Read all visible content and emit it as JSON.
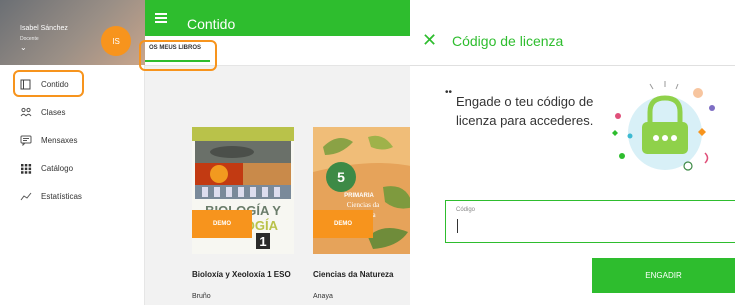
{
  "profile": {
    "name": "Isabel Sánchez",
    "role": "Docente",
    "initials": "IS"
  },
  "sidebar": {
    "items": [
      {
        "label": "Contido",
        "icon": "book-icon"
      },
      {
        "label": "Clases",
        "icon": "people-icon"
      },
      {
        "label": "Mensaxes",
        "icon": "message-icon"
      },
      {
        "label": "Catálogo",
        "icon": "grid-icon"
      },
      {
        "label": "Estatísticas",
        "icon": "chart-icon"
      }
    ]
  },
  "header": {
    "title": "Contido"
  },
  "tabs": [
    {
      "label": "OS MEUS LIBROS"
    }
  ],
  "books": [
    {
      "title": "Bioloxía y Xeoloxía 1 ESO",
      "publisher": "Bruño",
      "badge": "DEMO",
      "cover_text": "BIOLOGÍA Y GEOLOGÍA",
      "cover_number": "1"
    },
    {
      "title": "Ciencias da Natureza",
      "publisher": "Anaya",
      "badge": "DEMO",
      "cover_number": "5",
      "cover_grade": "PRIMARIA",
      "cover_subject": "Ciencias da Natureza"
    }
  ],
  "dialog": {
    "title": "Código de licenza",
    "message": "Engade o teu código de licenza para accederes.",
    "code_label": "Código",
    "submit_label": "ENGADIR"
  },
  "colors": {
    "accent_green": "#2ebd2e",
    "highlight_orange": "#f7941d"
  }
}
